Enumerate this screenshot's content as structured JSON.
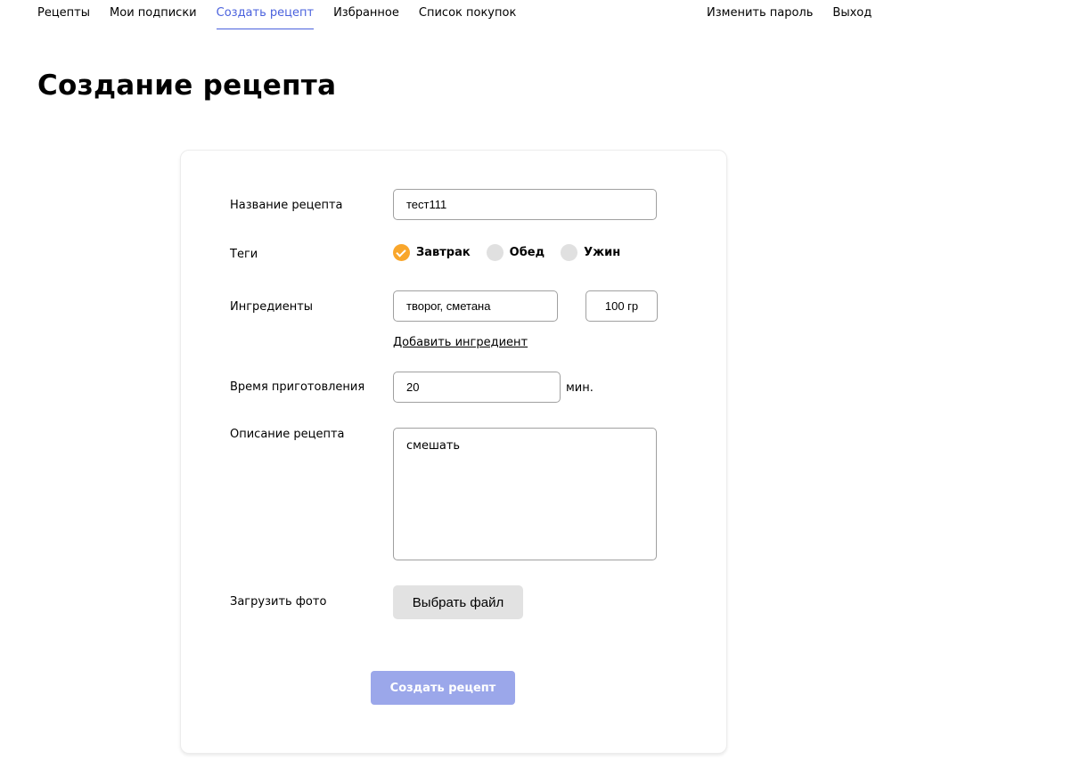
{
  "nav": {
    "items": [
      {
        "label": "Рецепты"
      },
      {
        "label": "Мои подписки"
      },
      {
        "label": "Создать рецепт",
        "active": true
      },
      {
        "label": "Избранное"
      },
      {
        "label": "Список покупок"
      }
    ],
    "change_password": "Изменить пароль",
    "logout": "Выход",
    "active_color": "#4a61dd"
  },
  "page": {
    "title": "Создание рецепта"
  },
  "form": {
    "name": {
      "label": "Название рецепта",
      "value": "тест111"
    },
    "tags": {
      "label": "Теги",
      "items": [
        {
          "label": "Завтрак",
          "checked": true,
          "color": "#f9a62b"
        },
        {
          "label": "Обед",
          "checked": false
        },
        {
          "label": "Ужин",
          "checked": false
        }
      ]
    },
    "ingredients": {
      "label": "Ингредиенты",
      "name_value": "творог, сметана",
      "amount_value": "100 гр",
      "add_label": "Добавить ингредиент"
    },
    "cooking_time": {
      "label": "Время приготовления",
      "value": "20",
      "unit": "мин."
    },
    "description": {
      "label": "Описание рецепта",
      "value": "смешать"
    },
    "photo": {
      "label": "Загрузить фото",
      "button_label": "Выбрать файл"
    },
    "submit_label": "Создать рецепт",
    "submit_color": "#9ba7ea"
  }
}
